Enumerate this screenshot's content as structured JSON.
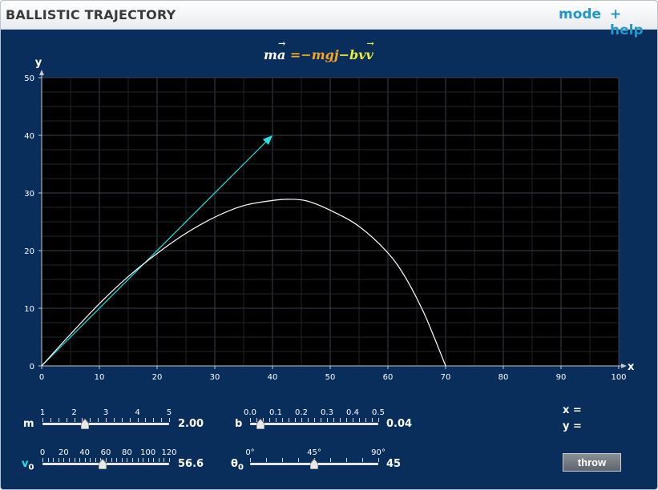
{
  "app": {
    "title": "BALLISTIC TRAJECTORY",
    "mode_label": "mode",
    "help_label": "+ help"
  },
  "equation": {
    "lhs_m": "m",
    "lhs_a": "a",
    "eq": "=",
    "gravity": "−mg",
    "j": "j",
    "drag": "−bv",
    "v": "v"
  },
  "colors": {
    "background": "#0a2e5c",
    "plot_bg": "#000000",
    "trajectory": "#ffffff",
    "velocity_arrow": "#22e3e6",
    "gravity_term": "#f5a623",
    "drag_term": "#e8ee3a",
    "link": "#1d98c8"
  },
  "chart_data": {
    "type": "line",
    "xlabel": "x",
    "ylabel": "y",
    "xlim": [
      0,
      100
    ],
    "ylim": [
      0,
      50
    ],
    "xticks": [
      0,
      10,
      20,
      30,
      40,
      50,
      60,
      70,
      80,
      90,
      100
    ],
    "yticks": [
      0,
      10,
      20,
      30,
      40,
      50
    ],
    "grid": true,
    "trajectory": {
      "x": [
        0,
        5,
        10,
        15,
        20,
        25,
        30,
        35,
        40,
        43,
        46,
        50,
        55,
        60,
        63,
        66,
        68,
        70
      ],
      "y": [
        0,
        5.5,
        10.8,
        15.5,
        19.5,
        23,
        25.8,
        27.8,
        28.7,
        28.9,
        28.6,
        27,
        24.2,
        19.6,
        15.4,
        9.7,
        5,
        0
      ]
    },
    "velocity_arrow": {
      "from": [
        0,
        0
      ],
      "to": [
        40,
        40
      ]
    }
  },
  "controls": {
    "m": {
      "label": "m",
      "ticks": [
        "1",
        "2",
        "3",
        "4",
        "5"
      ],
      "min": 0.5,
      "max": 5,
      "value": 2.0,
      "value_text": "2.00"
    },
    "b": {
      "label": "b",
      "ticks": [
        "0.0",
        "0.1",
        "0.2",
        "0.3",
        "0.4",
        "0.5"
      ],
      "min": 0,
      "max": 0.5,
      "value": 0.04,
      "value_text": "0.04"
    },
    "v0": {
      "label": "v",
      "sub": "0",
      "ticks": [
        "0",
        "20",
        "40",
        "60",
        "80",
        "100",
        "120"
      ],
      "min": 0,
      "max": 120,
      "value": 56.6,
      "value_text": "56.6"
    },
    "theta0": {
      "label": "θ",
      "sub": "0",
      "ticks": [
        "0°",
        "45°",
        "90°"
      ],
      "min": 0,
      "max": 90,
      "value": 45,
      "value_text": "45"
    }
  },
  "readout": {
    "x_label": "x =",
    "y_label": "y ="
  },
  "throw_label": "throw"
}
